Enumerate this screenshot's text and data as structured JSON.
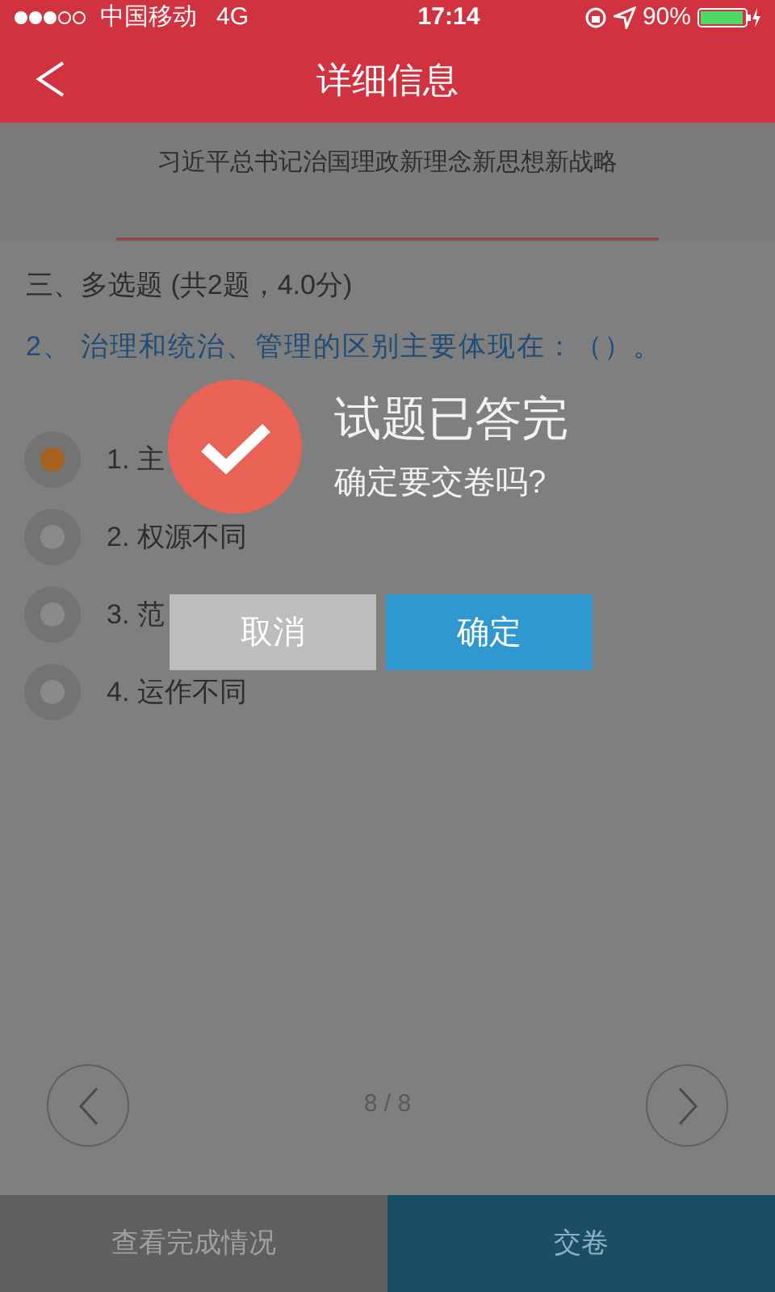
{
  "status_bar": {
    "carrier": "中国移动",
    "network": "4G",
    "time": "17:14",
    "battery": "90%"
  },
  "header": {
    "title": "详细信息"
  },
  "exam_title": "习近平总书记治国理政新理念新思想新战略",
  "section": "三、多选题 (共2题，4.0分)",
  "question": "2、 治理和统治、管理的区别主要体现在：（）。",
  "options": [
    {
      "label": "1. 主",
      "selected": true
    },
    {
      "label": "2. 权源不同",
      "selected": false
    },
    {
      "label": "3. 范",
      "selected": false
    },
    {
      "label": "4. 运作不同",
      "selected": false
    }
  ],
  "pager": "8 / 8",
  "bottom_bar": {
    "progress_button": "查看完成情况",
    "submit_button": "交卷"
  },
  "dialog": {
    "title": "试题已答完",
    "message": "确定要交卷吗?",
    "cancel": "取消",
    "confirm": "确定"
  }
}
